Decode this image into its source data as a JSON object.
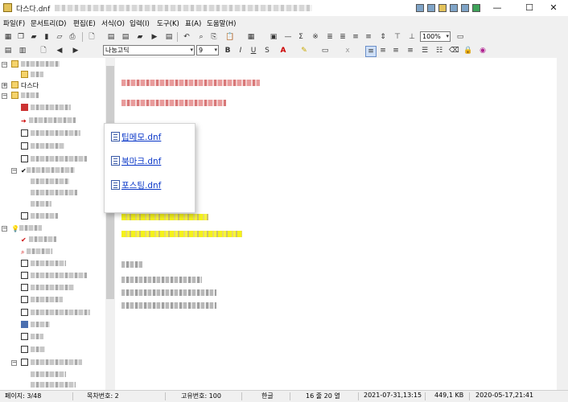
{
  "window": {
    "title": "다스다.dnf",
    "controls": [
      "minimize",
      "maximize",
      "close"
    ],
    "minimize": "—",
    "maximize": "☐",
    "close": "✕"
  },
  "menu": [
    "파일(F)",
    "문서트리(D)",
    "편집(E)",
    "서식(O)",
    "입력(I)",
    "도구(K)",
    "표(A)",
    "도움말(H)"
  ],
  "toolbar": {
    "zoom": "100%",
    "font": "나눔고딕",
    "size": "9",
    "bold": "B",
    "italic": "I",
    "underline": "U"
  },
  "tree": {
    "folder_label": "다스다"
  },
  "popup": {
    "links": [
      "팁메모.dnf",
      "북마크.dnf",
      "포스팅.dnf"
    ]
  },
  "status": {
    "page": "페이지: 3/48",
    "list": "목차번호: 2",
    "uid": "고유번호: 100",
    "lang": "한글",
    "pos": "16 줄 20 열",
    "date": "2021-07-31,13:15",
    "size": "449,1 KB",
    "created": "2020-05-17,21:41"
  }
}
